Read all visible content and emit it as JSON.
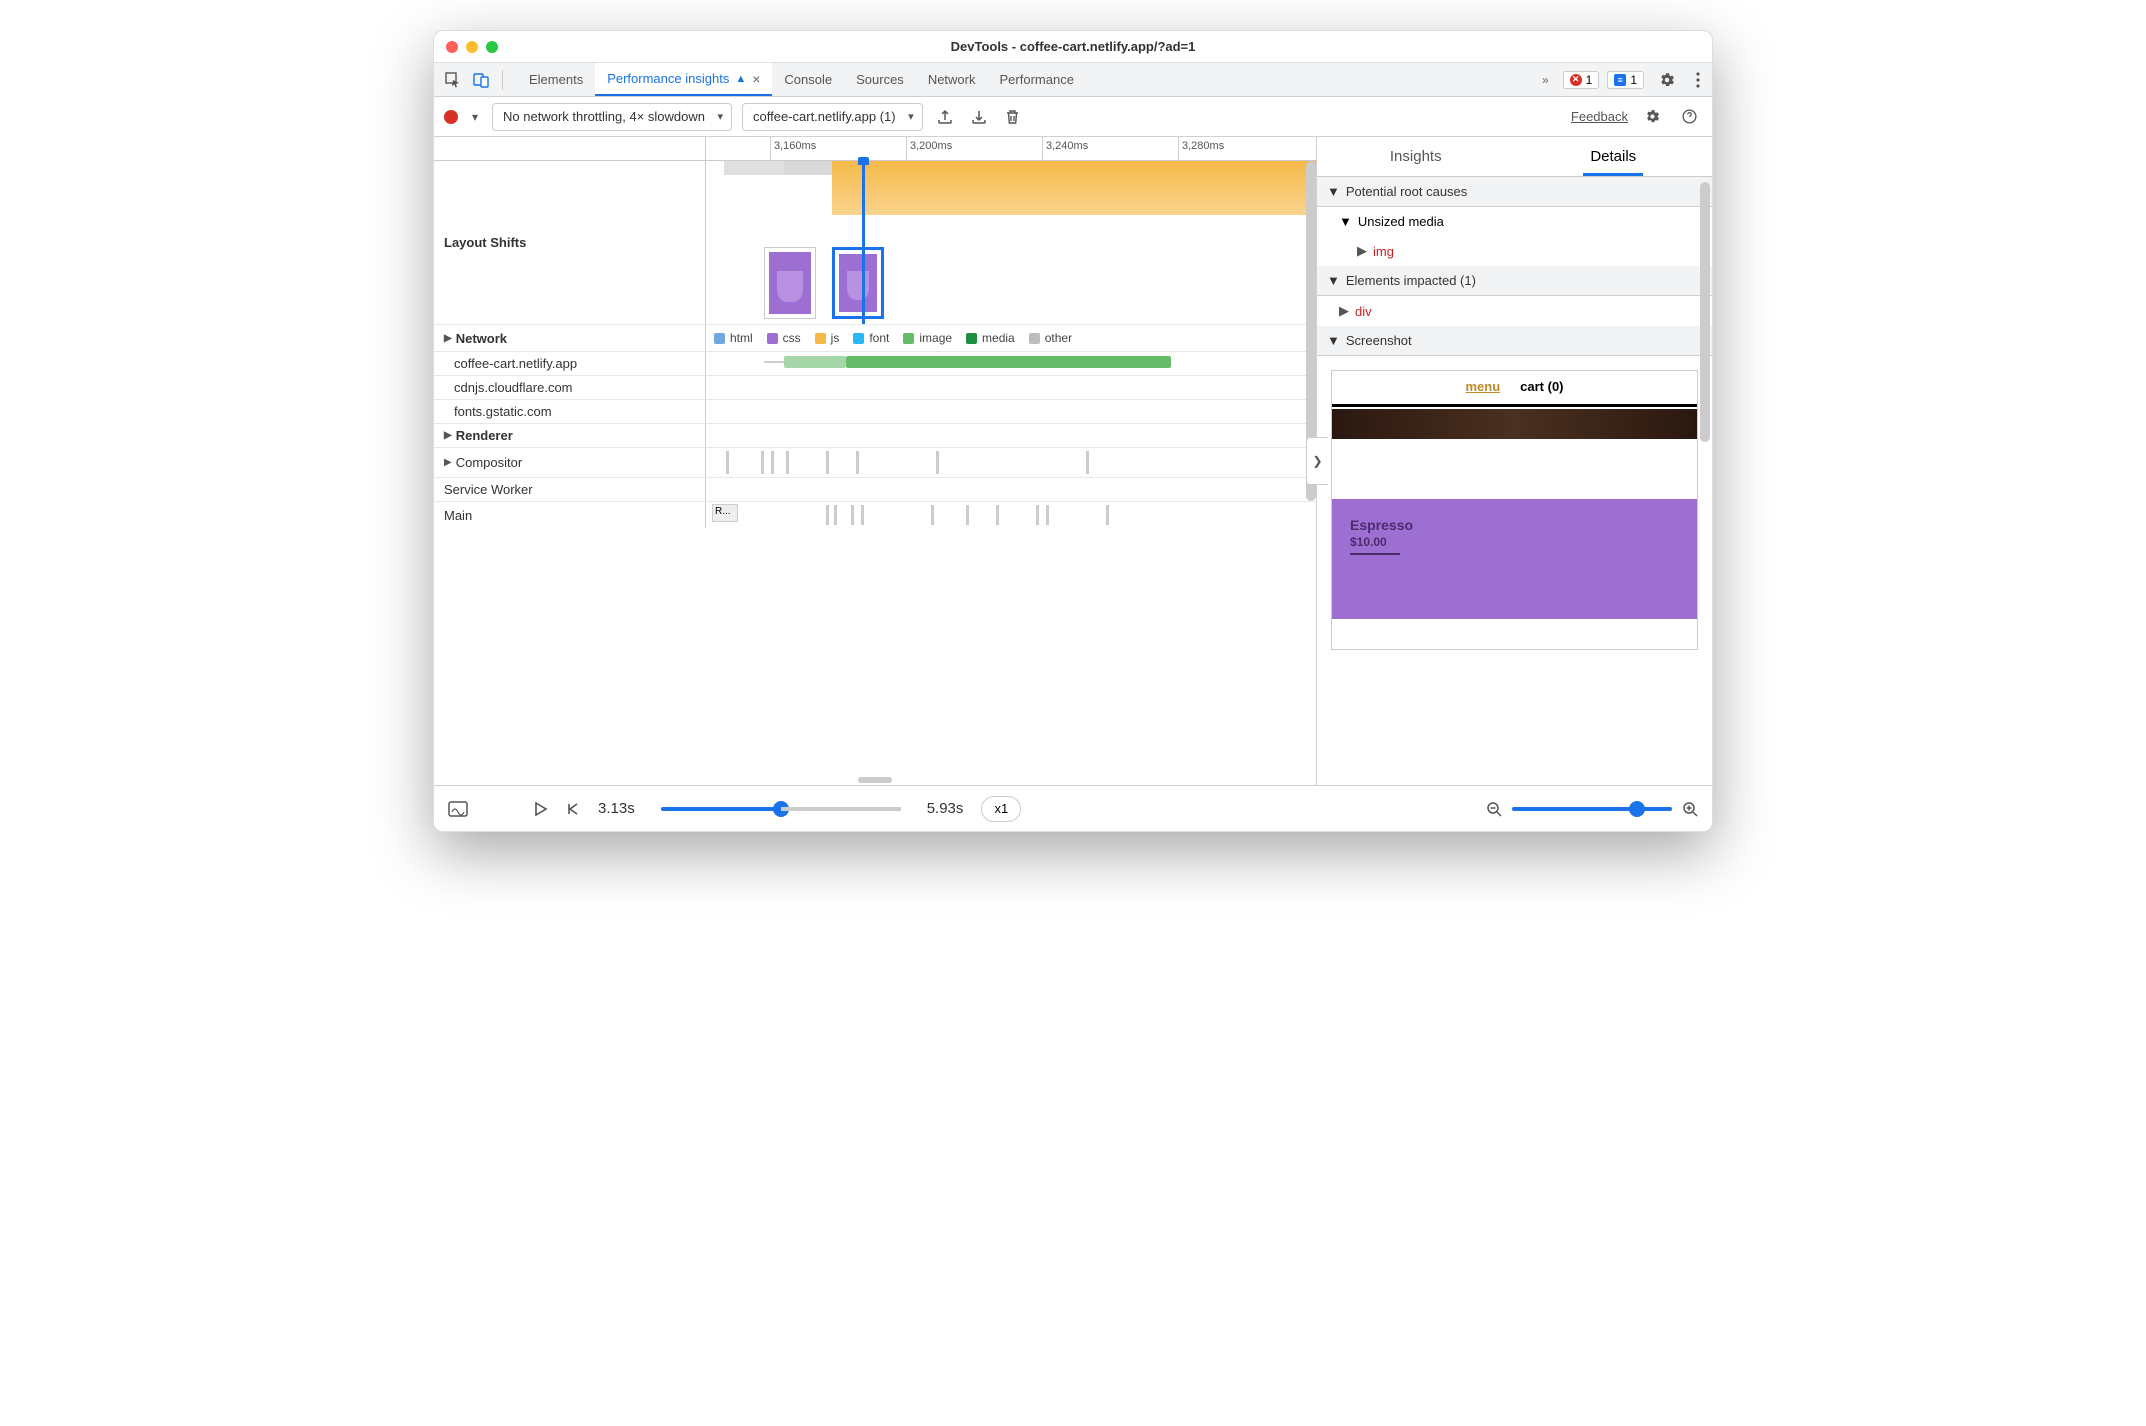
{
  "window": {
    "title": "DevTools - coffee-cart.netlify.app/?ad=1"
  },
  "tabs": {
    "items": [
      "Elements",
      "Performance insights",
      "Console",
      "Sources",
      "Network",
      "Performance"
    ],
    "active_index": 1
  },
  "badges": {
    "error_count": "1",
    "info_count": "1"
  },
  "toolbar": {
    "throttling": "No network throttling, 4× slowdown",
    "target": "coffee-cart.netlify.app (1)",
    "feedback": "Feedback"
  },
  "ruler": {
    "ticks": [
      "3,160ms",
      "3,200ms",
      "3,240ms",
      "3,280ms"
    ]
  },
  "tracks": {
    "layout_shifts": "Layout Shifts",
    "network": "Network",
    "renderer": "Renderer",
    "compositor": "Compositor",
    "service_worker": "Service Worker",
    "main": "Main",
    "main_task": "R...",
    "hosts": [
      "coffee-cart.netlify.app",
      "cdnjs.cloudflare.com",
      "fonts.gstatic.com"
    ]
  },
  "legend": {
    "html": "html",
    "css": "css",
    "js": "js",
    "font": "font",
    "image": "image",
    "media": "media",
    "other": "other"
  },
  "details": {
    "tabs": {
      "insights": "Insights",
      "details": "Details"
    },
    "sections": {
      "root_causes": "Potential root causes",
      "unsized_media": "Unsized media",
      "img_tag": "img",
      "elements_impacted": "Elements impacted (1)",
      "div_tag": "div",
      "screenshot": "Screenshot"
    },
    "preview": {
      "menu": "menu",
      "cart": "cart (0)",
      "product_name": "Espresso",
      "product_price": "$10.00"
    }
  },
  "bottombar": {
    "start_time": "3.13s",
    "end_time": "5.93s",
    "speed": "x1"
  },
  "colors": {
    "html": "#6fa8dc",
    "css": "#9d6fd3",
    "js": "#f5b948",
    "font": "#29b6f6",
    "image": "#66bb6a",
    "media": "#1e8e3e",
    "other": "#bdbdbd"
  }
}
